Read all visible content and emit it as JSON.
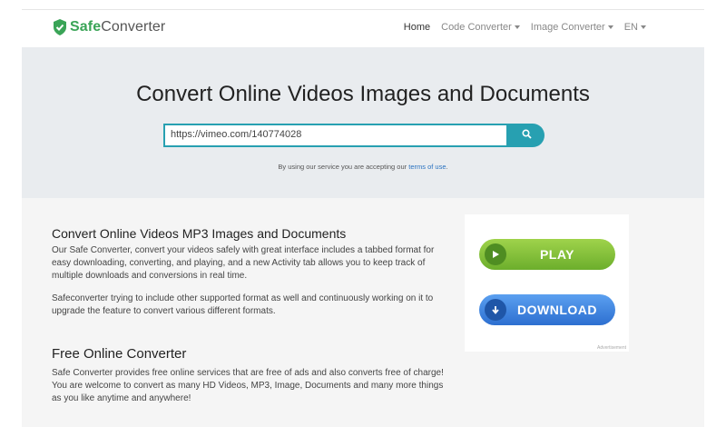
{
  "brand": {
    "part1": "Safe",
    "part2": "Converter"
  },
  "nav": {
    "home": "Home",
    "code_converter": "Code Converter",
    "image_converter": "Image Converter",
    "language": "EN"
  },
  "hero": {
    "title": "Convert Online Videos Images and Documents",
    "search_value": "https://vimeo.com/140774028",
    "terms_prefix": "By using our service you are accepting our",
    "terms_link": "terms of use",
    "terms_suffix": "."
  },
  "section1": {
    "heading": "Convert Online Videos MP3 Images and Documents",
    "p1_lines": [
      "Our Safe Converter, convert your videos safely with great interface includes a tabbed format for",
      "easy downloading, converting, and playing, and a new Activity tab allows you to keep track of",
      "multiple downloads and conversions in real time."
    ],
    "p2_lines": [
      "Safeconverter trying to include other supported format as well and continuously working on it to",
      "upgrade the feature to convert various different formats."
    ]
  },
  "section2": {
    "heading": "Free Online Converter",
    "p_lines": [
      "Safe Converter provides free online services that are free of ads and also converts free of charge!",
      "You are welcome to convert as many HD Videos, MP3, Image, Documents and many more things",
      "as you like anytime and anywhere!"
    ]
  },
  "ad": {
    "play_label": "PLAY",
    "download_label": "DOWNLOAD",
    "note": "Advertisement"
  },
  "colors": {
    "accent": "#27a0b1",
    "brand_green": "#3aa457",
    "play_green": "#7dbd35",
    "download_blue": "#3b7fdc",
    "link": "#2a72c0"
  }
}
